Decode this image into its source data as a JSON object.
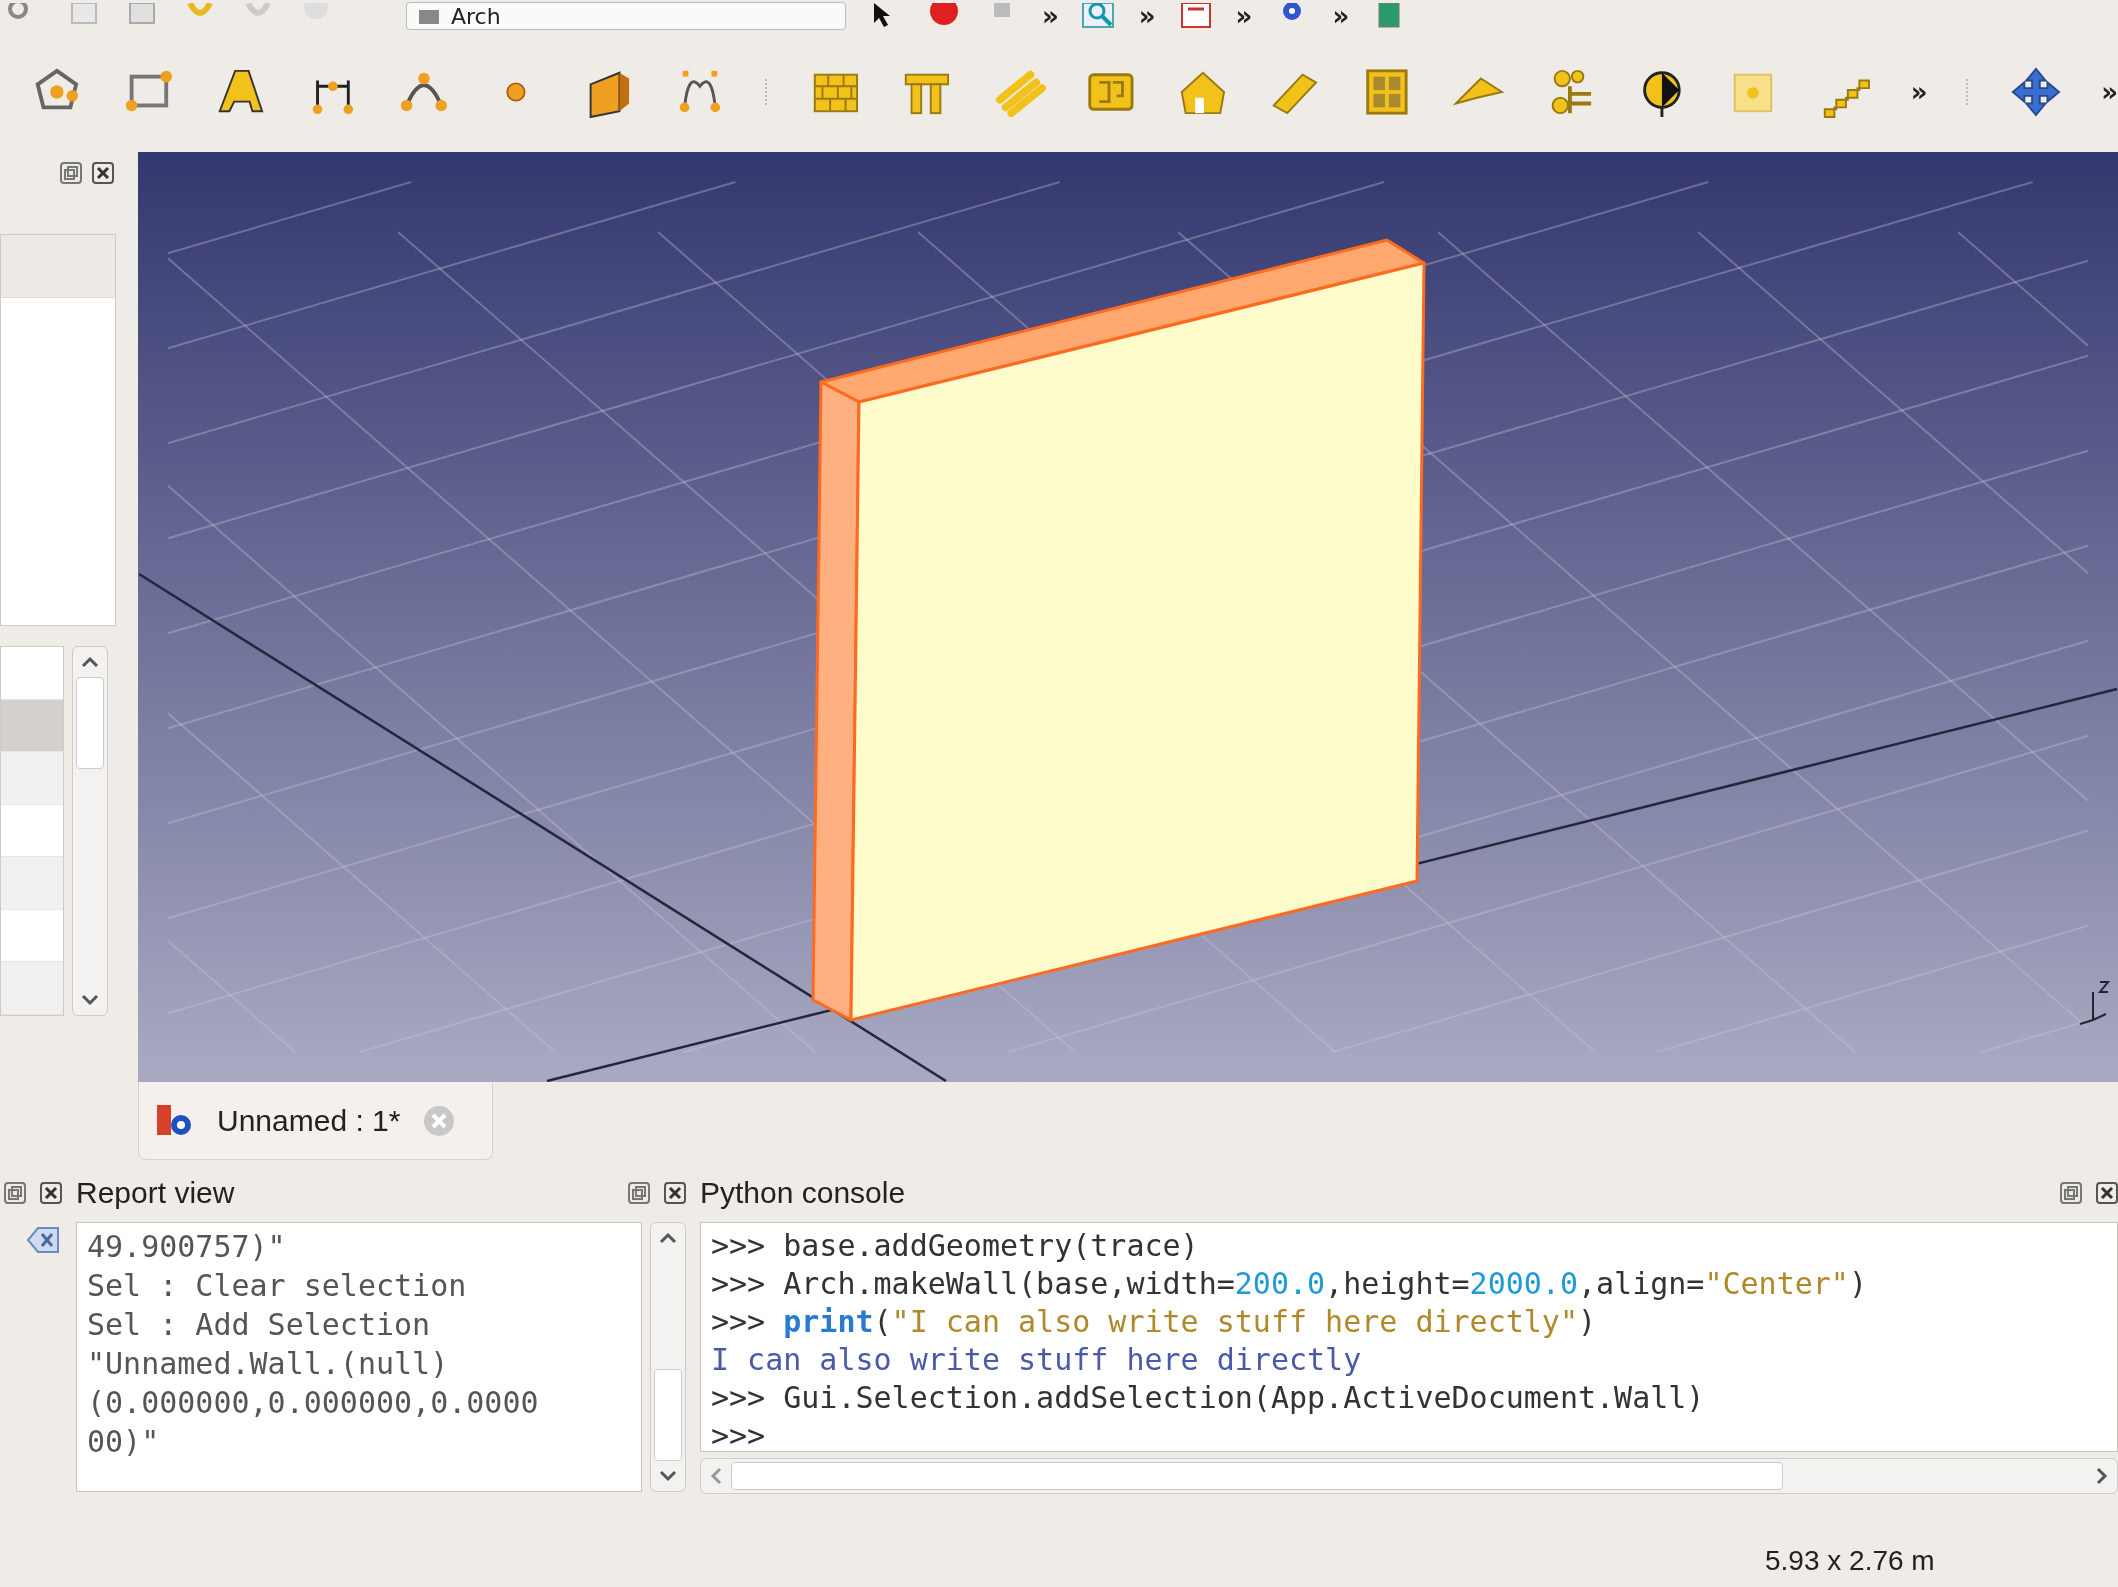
{
  "toolbar_top": {
    "workbench": "Arch",
    "items": [
      {
        "kind": "icon"
      },
      {
        "kind": "record"
      },
      {
        "kind": "icon"
      },
      {
        "kind": "overflow",
        "text": "»"
      },
      {
        "kind": "search"
      },
      {
        "kind": "overflow",
        "text": "»"
      },
      {
        "kind": "doc"
      },
      {
        "kind": "overflow",
        "text": "»"
      },
      {
        "kind": "gear"
      },
      {
        "kind": "overflow",
        "text": "»"
      },
      {
        "kind": "book"
      }
    ]
  },
  "toolbar": {
    "overflow": "»",
    "overflow_end": "»"
  },
  "document_tab": {
    "title": "Unnamed : 1*"
  },
  "report_view": {
    "title": "Report view",
    "lines": [
      "49.900757)\"",
      "Sel : Clear selection",
      "Sel : Add Selection",
      "\"Unnamed.Wall.(null)",
      "(0.000000,0.000000,0.0000",
      "00)\""
    ]
  },
  "python_console": {
    "title": "Python console",
    "lines": [
      {
        "tokens": [
          {
            "kind": "prompt",
            "text": ">>>"
          },
          {
            "kind": "plain",
            "text": "base.addGeometry(trace)"
          }
        ]
      },
      {
        "tokens": [
          {
            "kind": "prompt",
            "text": ">>>"
          },
          {
            "kind": "plain",
            "text": "Arch.makeWall(base,width="
          },
          {
            "kind": "number",
            "text": "200.0"
          },
          {
            "kind": "plain",
            "text": ",height="
          },
          {
            "kind": "number",
            "text": "2000.0"
          },
          {
            "kind": "plain",
            "text": ",align="
          },
          {
            "kind": "string",
            "text": "\"Center\""
          },
          {
            "kind": "plain",
            "text": ")"
          }
        ]
      },
      {
        "tokens": [
          {
            "kind": "prompt",
            "text": ">>>"
          },
          {
            "kind": "keyword",
            "text": "print"
          },
          {
            "kind": "plain",
            "text": "("
          },
          {
            "kind": "string",
            "text": "\"I can also write stuff here directly\""
          },
          {
            "kind": "plain",
            "text": ")"
          }
        ]
      },
      {
        "tokens": [
          {
            "kind": "output",
            "text": "I can also write stuff here directly"
          }
        ]
      },
      {
        "tokens": [
          {
            "kind": "prompt",
            "text": ">>>"
          },
          {
            "kind": "plain",
            "text": "Gui.Selection.addSelection(App.ActiveDocument.Wall)"
          }
        ]
      },
      {
        "tokens": [
          {
            "kind": "prompt",
            "text": ">>>"
          }
        ]
      }
    ]
  },
  "status_bar": {
    "dimensions": "5.93 x 2.76 m"
  }
}
